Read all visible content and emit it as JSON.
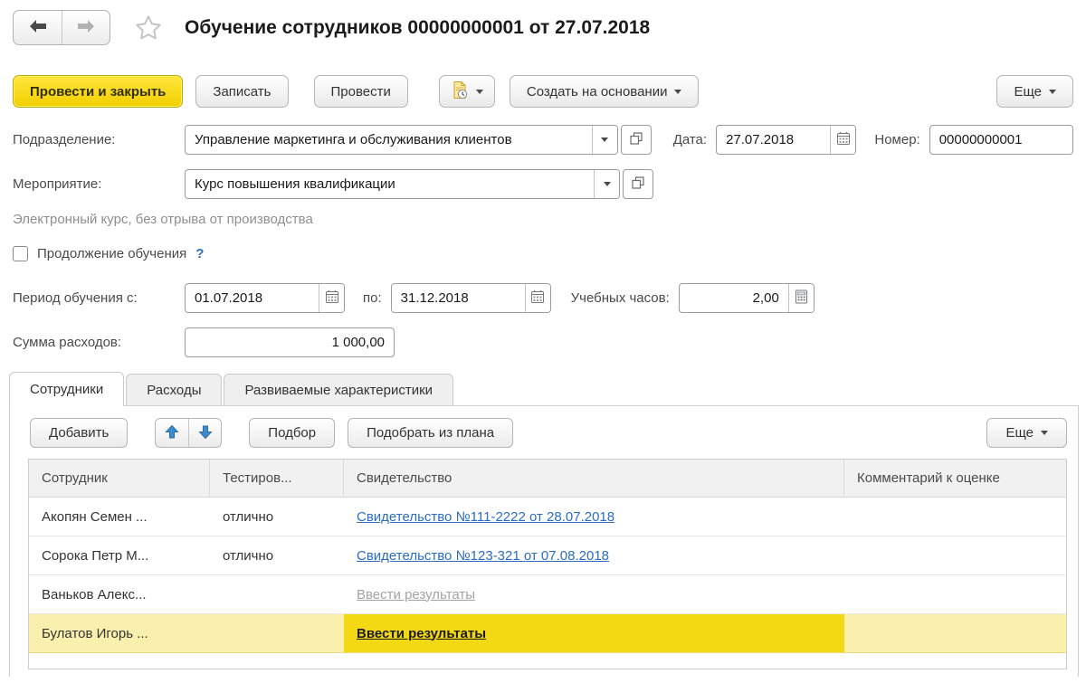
{
  "header": {
    "title": "Обучение сотрудников 00000000001 от 27.07.2018"
  },
  "toolbar": {
    "post_and_close": "Провести и закрыть",
    "save": "Записать",
    "post": "Провести",
    "create_based_on": "Создать на основании",
    "more": "Еще"
  },
  "fields": {
    "department": {
      "label": "Подразделение:",
      "value": "Управление маркетинга и обслуживания клиентов"
    },
    "date": {
      "label": "Дата:",
      "value": "27.07.2018"
    },
    "number": {
      "label": "Номер:",
      "value": "00000000001"
    },
    "event": {
      "label": "Мероприятие:",
      "value": "Курс повышения квалификации"
    },
    "event_hint": "Электронный курс, без отрыва от производства",
    "continuation": {
      "label": "Продолжение обучения",
      "help": "?",
      "checked": false
    },
    "period_from": {
      "label": "Период обучения с:",
      "value": "01.07.2018"
    },
    "period_to": {
      "label": "по:",
      "value": "31.12.2018"
    },
    "hours": {
      "label": "Учебных часов:",
      "value": "2,00"
    },
    "amount": {
      "label": "Сумма расходов:",
      "value": "1 000,00"
    }
  },
  "tabs": [
    {
      "label": "Сотрудники",
      "active": true
    },
    {
      "label": "Расходы",
      "active": false
    },
    {
      "label": "Развиваемые характеристики",
      "active": false
    }
  ],
  "grid_toolbar": {
    "add": "Добавить",
    "pick": "Подбор",
    "pick_from_plan": "Подобрать из плана",
    "more": "Еще"
  },
  "table": {
    "columns": [
      "Сотрудник",
      "Тестиров...",
      "Свидетельство",
      "Комментарий к оценке"
    ],
    "rows": [
      {
        "employee": "Акопян Семен ...",
        "testing": "отлично",
        "certificate": "Свидетельство №111-2222 от 28.07.2018",
        "certificate_style": "link",
        "comment": "",
        "selected": false
      },
      {
        "employee": "Сорока Петр М...",
        "testing": "отлично",
        "certificate": "Свидетельство №123-321 от 07.08.2018",
        "certificate_style": "link",
        "comment": "",
        "selected": false
      },
      {
        "employee": "Ваньков Алекс...",
        "testing": "",
        "certificate": "Ввести результаты",
        "certificate_style": "placeholder",
        "comment": "",
        "selected": false
      },
      {
        "employee": "Булатов Игорь ...",
        "testing": "",
        "certificate": "Ввести результаты",
        "certificate_style": "active",
        "comment": "",
        "selected": true
      }
    ]
  },
  "icons": {
    "nav_back": "arrow-left",
    "nav_forward": "arrow-right",
    "favorite": "star-outline",
    "post_document": "document-with-clock",
    "dropdown": "caret-down",
    "open_value": "overlapping-squares",
    "calendar": "calendar",
    "calculator": "calculator",
    "move_up": "blue-arrow-up",
    "move_down": "blue-arrow-down"
  },
  "colors": {
    "primary_button_yellow": "#f7d500",
    "selected_row_pale": "#faf0ae",
    "selected_cell_yellow": "#f3d914",
    "link_blue": "#2b6cc4",
    "placeholder_gray": "#a3a3a3",
    "hint_gray": "#8f8f8f"
  }
}
